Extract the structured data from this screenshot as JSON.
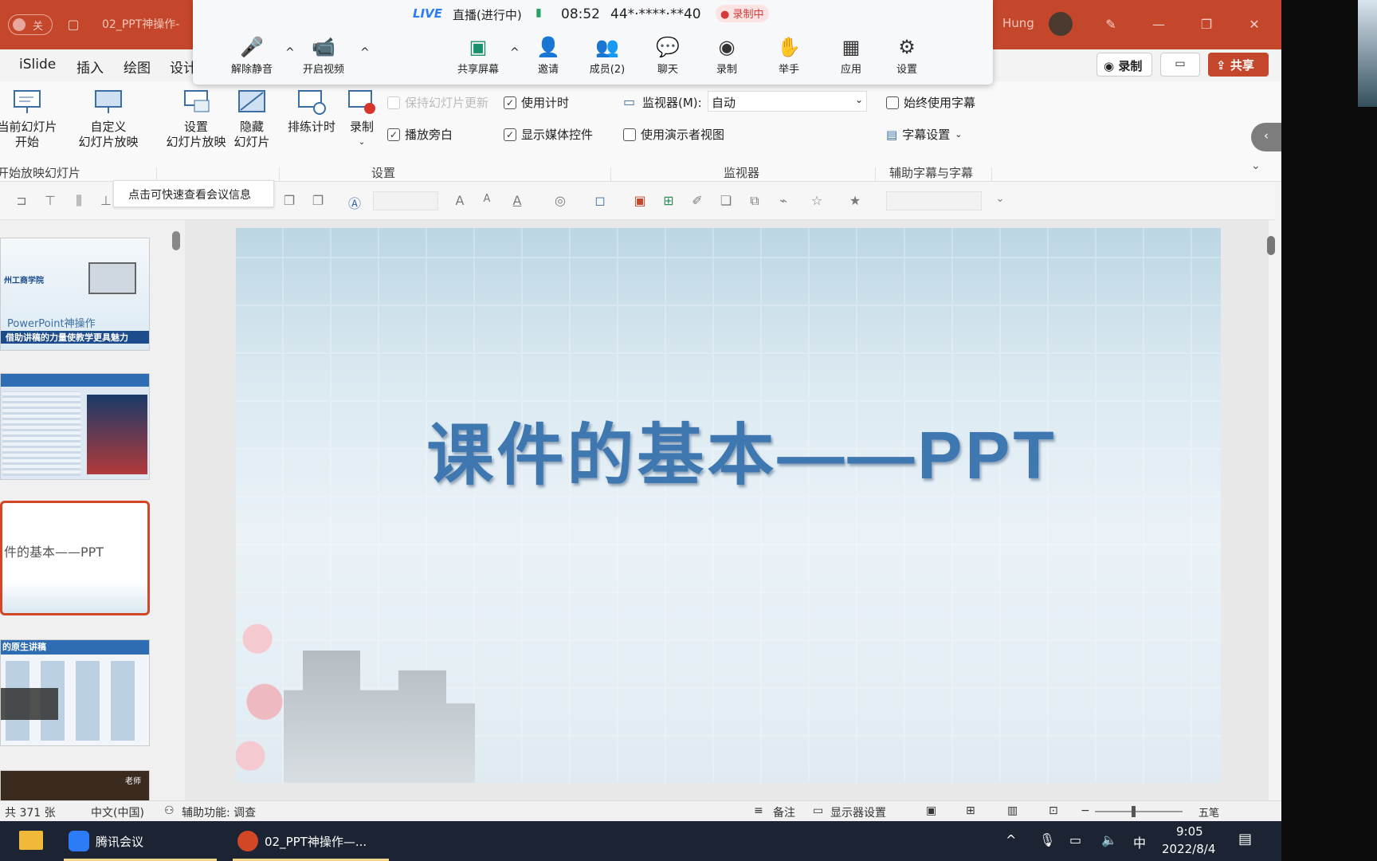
{
  "titlebar": {
    "toggle_label": "关",
    "doc_title": "02_PPT神操作-",
    "user_name": "Hung"
  },
  "menubar": {
    "items": [
      "iSlide",
      "插入",
      "绘图",
      "设计"
    ],
    "record_label": "录制",
    "share_label": "共享"
  },
  "ribbon": {
    "btn_from_current": "当前幻灯片\n开始",
    "btn_custom": "自定义\n幻灯片放映",
    "btn_setup": "设置\n幻灯片放映",
    "btn_hide": "隐藏\n幻灯片",
    "btn_rehearse": "排练计时",
    "btn_record": "录制",
    "chk_keep_updated": "保持幻灯片更新",
    "chk_use_timings": "使用计时",
    "chk_narration": "播放旁白",
    "chk_media_controls": "显示媒体控件",
    "monitor_label": "监视器(M):",
    "monitor_value": "自动",
    "chk_presenter_view": "使用演示者视图",
    "chk_always_subtitles": "始终使用字幕",
    "subtitle_settings": "字幕设置",
    "group_start": "开始放映幻灯片",
    "group_setup": "设置",
    "group_monitor": "监视器",
    "group_captions": "辅助字幕与字幕"
  },
  "tooltip": "点击可快速查看会议信息",
  "meeting": {
    "live_badge": "LIVE",
    "live_status": "直播(进行中)",
    "time": "08:52",
    "meeting_id": "44*·****·**40",
    "recording": "录制中",
    "buttons": [
      "解除静音",
      "开启视频",
      "共享屏幕",
      "邀请",
      "成员(2)",
      "聊天",
      "录制",
      "举手",
      "应用",
      "设置"
    ]
  },
  "thumbs": {
    "t1_school": "州工商学院",
    "t1_title": "PowerPoint神操作",
    "t1_banner": "借助讲稿的力量使教学更具魅力",
    "t3_text": "件的基本——PPT",
    "t4_text": "的原生讲稿",
    "t5_text": "老师"
  },
  "slide": {
    "title": "课件的基本——PPT"
  },
  "statusbar": {
    "slides": "共 371 张",
    "lang": "中文(中国)",
    "accessibility": "辅助功能: 调查",
    "notes": "备注",
    "display_settings": "显示器设置"
  },
  "taskbar": {
    "app1": "腾讯会议",
    "app2": "02_PPT神操作—...",
    "ime": "中",
    "time": "9:05",
    "date": "2022/8/4",
    "ime_wubi": "五笔"
  },
  "colors": {
    "accent": "#c4472c",
    "slide_title": "#3f77b0",
    "select": "#d24726"
  }
}
